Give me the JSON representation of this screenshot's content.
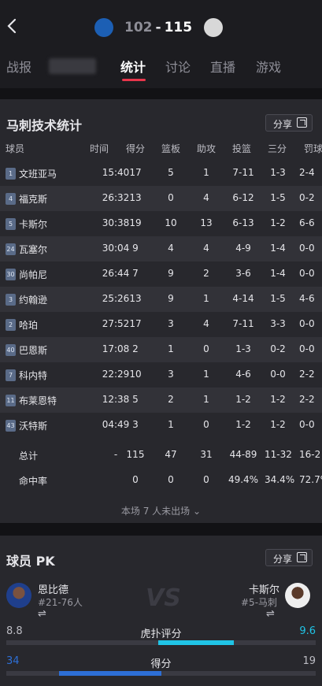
{
  "header": {
    "back_icon": "chevron-left-icon",
    "home_score": "102",
    "separator": "-",
    "away_score": "115"
  },
  "tabs": [
    {
      "label": "战报"
    },
    {
      "label": "统计"
    },
    {
      "label": "讨论"
    },
    {
      "label": "直播"
    },
    {
      "label": "游戏"
    }
  ],
  "stats": {
    "title": "马刺技术统计",
    "share_label": "分享",
    "columns": [
      "球员",
      "时间",
      "得分",
      "篮板",
      "助攻",
      "投篮",
      "三分",
      "罚球"
    ],
    "rows": [
      {
        "num": "1",
        "name": "文班亚马",
        "min": "15:40",
        "pts": "17",
        "reb": "5",
        "ast": "1",
        "fg": "7-11",
        "tp": "1-3",
        "ft": "2-4"
      },
      {
        "num": "4",
        "name": "福克斯",
        "min": "26:32",
        "pts": "13",
        "reb": "0",
        "ast": "4",
        "fg": "6-12",
        "tp": "1-5",
        "ft": "0-2"
      },
      {
        "num": "5",
        "name": "卡斯尔",
        "min": "30:38",
        "pts": "19",
        "reb": "10",
        "ast": "13",
        "fg": "6-13",
        "tp": "1-2",
        "ft": "6-6"
      },
      {
        "num": "24",
        "name": "瓦塞尔",
        "min": "30:04",
        "pts": "9",
        "reb": "4",
        "ast": "4",
        "fg": "4-9",
        "tp": "1-4",
        "ft": "0-0"
      },
      {
        "num": "30",
        "name": "尚帕尼",
        "min": "26:44",
        "pts": "7",
        "reb": "9",
        "ast": "2",
        "fg": "3-6",
        "tp": "1-4",
        "ft": "0-0"
      },
      {
        "num": "3",
        "name": "约翰逊",
        "min": "25:26",
        "pts": "13",
        "reb": "9",
        "ast": "1",
        "fg": "4-14",
        "tp": "1-5",
        "ft": "4-6"
      },
      {
        "num": "2",
        "name": "哈珀",
        "min": "27:52",
        "pts": "17",
        "reb": "3",
        "ast": "4",
        "fg": "7-11",
        "tp": "3-3",
        "ft": "0-0"
      },
      {
        "num": "40",
        "name": "巴恩斯",
        "min": "17:08",
        "pts": "2",
        "reb": "1",
        "ast": "0",
        "fg": "1-3",
        "tp": "0-2",
        "ft": "0-0"
      },
      {
        "num": "7",
        "name": "科内特",
        "min": "22:29",
        "pts": "10",
        "reb": "3",
        "ast": "1",
        "fg": "4-6",
        "tp": "0-0",
        "ft": "2-2"
      },
      {
        "num": "11",
        "name": "布莱恩特",
        "min": "12:38",
        "pts": "5",
        "reb": "2",
        "ast": "1",
        "fg": "1-2",
        "tp": "1-2",
        "ft": "2-2"
      },
      {
        "num": "43",
        "name": "沃特斯",
        "min": "04:49",
        "pts": "3",
        "reb": "1",
        "ast": "0",
        "fg": "1-2",
        "tp": "1-2",
        "ft": "0-0"
      }
    ],
    "total": {
      "label": "总计",
      "min": "-",
      "pts": "115",
      "reb": "47",
      "ast": "31",
      "fg": "44-89",
      "tp": "11-32",
      "ft": "16-2"
    },
    "pct": {
      "label": "命中率",
      "pts": "0",
      "reb": "0",
      "ast": "0",
      "fg": "49.4%",
      "tp": "34.4%",
      "ft": "72.7%"
    },
    "not_played": "本场 7 人未出场 ⌄"
  },
  "pk": {
    "title": "球员 PK",
    "share_label": "分享",
    "left": {
      "name": "恩比德",
      "sub": "#21-76人",
      "swap": "⇌"
    },
    "right": {
      "name": "卡斯尔",
      "sub": "#5-马刺",
      "swap": "⇌"
    },
    "vs": "VS",
    "metrics": [
      {
        "label": "虎扑评分",
        "left": "8.8",
        "right": "9.6",
        "left_color": "#bdbdc4",
        "right_color": "#20c4e6",
        "left_fill": 0.0,
        "right_fill": 1.0
      },
      {
        "label": "得分",
        "left": "34",
        "right": "19",
        "left_color": "#2d6fd6",
        "right_color": "#bdbdc4",
        "left_fill": 1.0,
        "right_fill": 0.0
      }
    ]
  }
}
